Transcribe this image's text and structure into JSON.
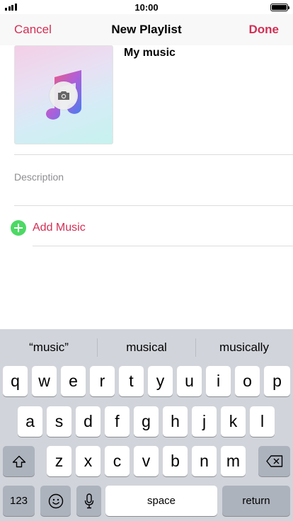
{
  "status_bar": {
    "time": "10:00"
  },
  "nav": {
    "cancel": "Cancel",
    "title": "New Playlist",
    "done": "Done"
  },
  "playlist": {
    "name": "My music",
    "description_placeholder": "Description",
    "add_music": "Add Music"
  },
  "keyboard": {
    "suggestions": [
      "“music”",
      "musical",
      "musically"
    ],
    "row1": [
      "q",
      "w",
      "e",
      "r",
      "t",
      "y",
      "u",
      "i",
      "o",
      "p"
    ],
    "row2": [
      "a",
      "s",
      "d",
      "f",
      "g",
      "h",
      "j",
      "k",
      "l"
    ],
    "row3": [
      "z",
      "x",
      "c",
      "v",
      "b",
      "n",
      "m"
    ],
    "numbers_key": "123",
    "space_key": "space",
    "return_key": "return",
    "icons": [
      "shift-icon",
      "backspace-icon",
      "emoji-icon",
      "microphone-icon"
    ]
  },
  "colors": {
    "accent": "#d22f55",
    "add_green": "#4cd964",
    "keyboard_bg": "#d1d4da"
  }
}
